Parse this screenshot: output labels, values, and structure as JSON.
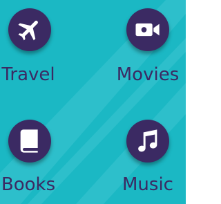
{
  "colors": {
    "background": "#1bb8c4",
    "stripe": "#3fc6d2",
    "circle": "#3b2a63",
    "icon": "#ffffff",
    "label": "#3b2a63"
  },
  "tiles": [
    {
      "label": "Travel",
      "icon": "airplane-icon"
    },
    {
      "label": "Movies",
      "icon": "video-camera-icon"
    },
    {
      "label": "Books",
      "icon": "book-icon"
    },
    {
      "label": "Music",
      "icon": "music-note-icon"
    }
  ]
}
